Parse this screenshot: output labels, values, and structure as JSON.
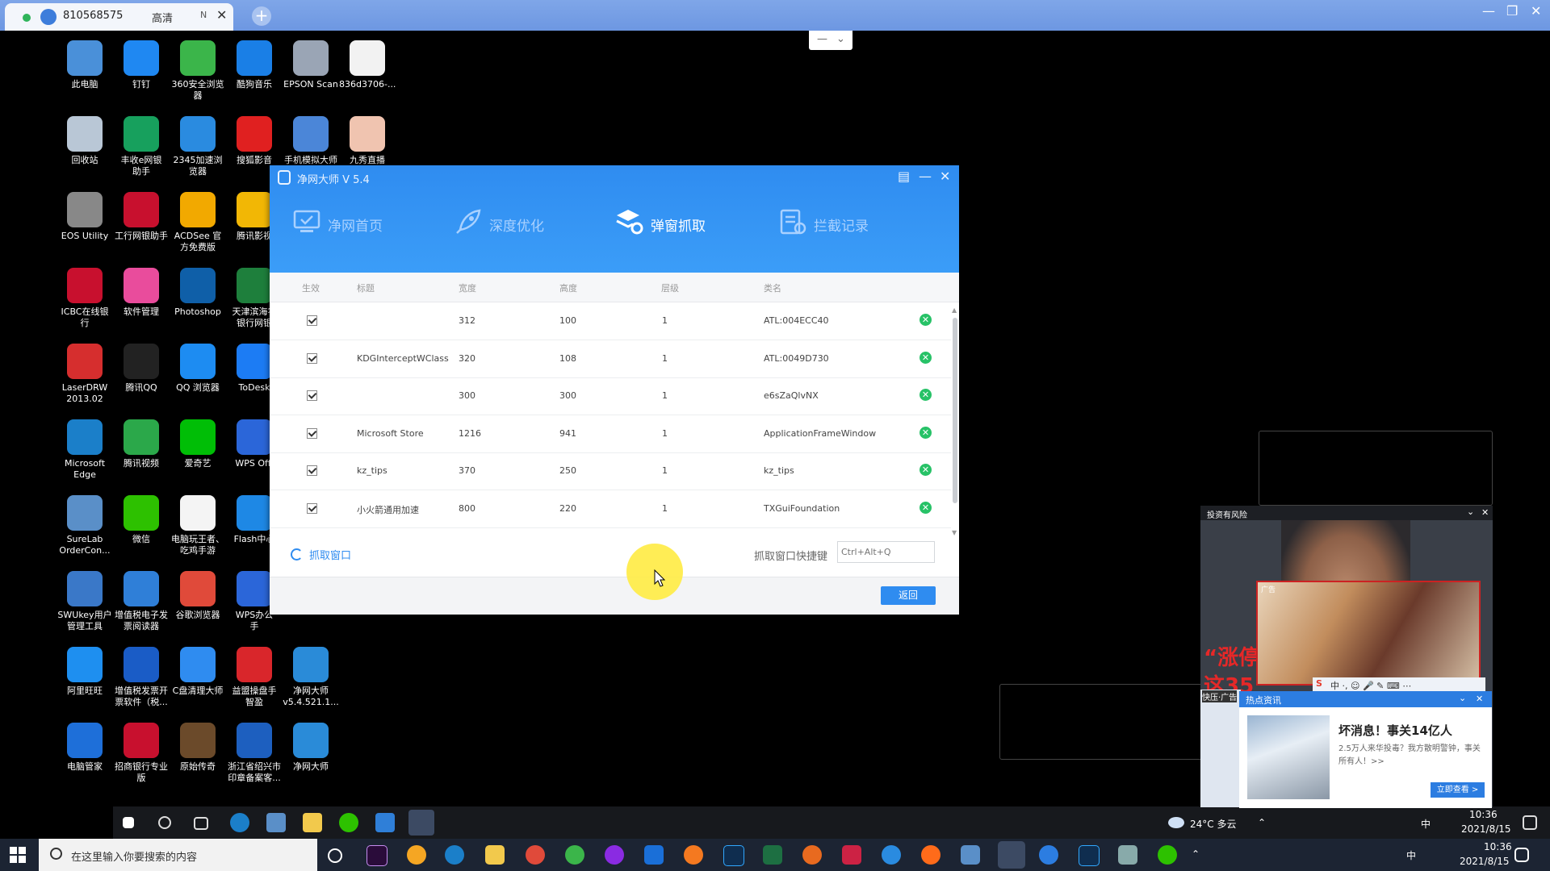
{
  "remote_client": {
    "tab_id": "810568575",
    "quality": "高清",
    "tab_extra": "N",
    "close_glyph": "✕",
    "new_tab_glyph": "+",
    "window_controls": [
      "—",
      "❐",
      "✕"
    ],
    "mini_toolbar": [
      "—",
      "⌄"
    ]
  },
  "desktop_icons": [
    {
      "label": "此电脑",
      "color": "#4a90d9"
    },
    {
      "label": "钉钉",
      "color": "#1f88f2"
    },
    {
      "label": "360安全浏览\n器",
      "color": "#3bb54a"
    },
    {
      "label": "酷狗音乐",
      "color": "#1a7fe6"
    },
    {
      "label": "EPSON Scan",
      "color": "#9aa5b5"
    },
    {
      "label": "836d3706-...",
      "color": "#f2f2f2"
    },
    {
      "label": "回收站",
      "color": "#b9c7d6"
    },
    {
      "label": "丰收e网银\n助手",
      "color": "#17a05d"
    },
    {
      "label": "2345加速浏\n览器",
      "color": "#2a8be0"
    },
    {
      "label": "搜狐影音",
      "color": "#e02020"
    },
    {
      "label": "手机模拟大师",
      "color": "#4b86d8"
    },
    {
      "label": "九秀直播",
      "color": "#f0c4b0"
    },
    {
      "label": "EOS Utility",
      "color": "#888888"
    },
    {
      "label": "工行网银助手",
      "color": "#c8102e"
    },
    {
      "label": "ACDSee 官\n方免费版",
      "color": "#f2a900"
    },
    {
      "label": "腾讯影视",
      "color": "#f2b705"
    },
    {
      "label": "ICBC在线银\n行",
      "color": "#c8102e"
    },
    {
      "label": "软件管理",
      "color": "#e94c9c"
    },
    {
      "label": "Photoshop",
      "color": "#0f5fa8"
    },
    {
      "label": "天津滨海农\n银行网银",
      "color": "#1e7f3c"
    },
    {
      "label": "LaserDRW\n2013.02",
      "color": "#d62e2e"
    },
    {
      "label": "腾讯QQ",
      "color": "#222222"
    },
    {
      "label": "QQ 浏览器",
      "color": "#1d8cf2"
    },
    {
      "label": "ToDesk",
      "color": "#1c7cf4"
    },
    {
      "label": "Microsoft\nEdge",
      "color": "#1b7fc9"
    },
    {
      "label": "腾讯视频",
      "color": "#2ba84a"
    },
    {
      "label": "爱奇艺",
      "color": "#00be06"
    },
    {
      "label": "WPS Offi",
      "color": "#2b66d9"
    },
    {
      "label": "SureLab\nOrderCon...",
      "color": "#5a8fc8"
    },
    {
      "label": "微信",
      "color": "#2dc100"
    },
    {
      "label": "电脑玩王者、\n吃鸡手游",
      "color": "#f4f4f4"
    },
    {
      "label": "Flash中心",
      "color": "#1e88e5"
    },
    {
      "label": "SWUkey用户\n管理工具",
      "color": "#3a78c8"
    },
    {
      "label": "增值税电子发\n票阅读器",
      "color": "#2f7fd8"
    },
    {
      "label": "谷歌浏览器",
      "color": "#e04a3a"
    },
    {
      "label": "WPS办公\n手",
      "color": "#2b66d9"
    },
    {
      "label": "阿里旺旺",
      "color": "#1e8ff0"
    },
    {
      "label": "增值税发票开\n票软件（税...",
      "color": "#1a5cc6"
    },
    {
      "label": "C盘清理大师",
      "color": "#2f8cf0"
    },
    {
      "label": "益盟操盘手\n智盈",
      "color": "#d9262b"
    },
    {
      "label": "净网大师\nv5.4.521.1...",
      "color": "#2a8bd8"
    },
    {
      "label": "电脑管家",
      "color": "#1e6fd9"
    },
    {
      "label": "招商银行专业\n版",
      "color": "#c8102e"
    },
    {
      "label": "原始传奇",
      "color": "#6b4a2a"
    },
    {
      "label": "浙江省绍兴市\n印章备案客...",
      "color": "#1d5fbf"
    },
    {
      "label": "净网大师",
      "color": "#2a8bd8"
    }
  ],
  "app": {
    "title": "净网大师 V 5.4",
    "controls": [
      "▤",
      "—",
      "✕"
    ],
    "tabs": [
      {
        "label": "净网首页",
        "icon": "monitor-check-icon"
      },
      {
        "label": "深度优化",
        "icon": "rocket-icon"
      },
      {
        "label": "弹窗抓取",
        "icon": "grab-popup-icon"
      },
      {
        "label": "拦截记录",
        "icon": "intercept-log-icon"
      }
    ],
    "columns": [
      "生效",
      "标题",
      "宽度",
      "高度",
      "层级",
      "类名"
    ],
    "rows": [
      {
        "title": "",
        "width": "312",
        "height": "100",
        "level": "1",
        "class": "ATL:004ECC40"
      },
      {
        "title": "KDGInterceptWClass",
        "width": "320",
        "height": "108",
        "level": "1",
        "class": "ATL:0049D730"
      },
      {
        "title": "",
        "width": "300",
        "height": "300",
        "level": "1",
        "class": "e6sZaQlvNX"
      },
      {
        "title": "Microsoft Store",
        "width": "1216",
        "height": "941",
        "level": "1",
        "class": "ApplicationFrameWindow"
      },
      {
        "title": "kz_tips",
        "width": "370",
        "height": "250",
        "level": "1",
        "class": "kz_tips"
      },
      {
        "title": "小火箭通用加速",
        "width": "800",
        "height": "220",
        "level": "1",
        "class": "TXGuiFoundation"
      }
    ],
    "grab_label": "抓取窗口",
    "hotkey_label": "抓取窗口快捷键",
    "hotkey_placeholder": "Ctrl+Alt+Q",
    "back_label": "返回",
    "accent": "#2f8cf0",
    "ok_color": "#27c267"
  },
  "popups": {
    "video_title": "投资有风险",
    "video_caption_1": "“涨停",
    "video_caption_2": "这35",
    "ad_label": "广告",
    "ime_text": "中 ·, ☺ 🎤 ✎ ⌨ ⋯",
    "side_ad_label": "快压·广告",
    "news_header": "热点资讯",
    "news_title": "坏消息！事关14亿人",
    "news_body": "2.5万人来华投毒？我方散明警钟，事关所有人！>>",
    "news_button": "立即查看 >",
    "close_glyph": "✕",
    "expand_glyph": "⌄"
  },
  "remote_taskbar": {
    "weather": "24°C 多云",
    "time": "10:36",
    "date": "2021/8/15",
    "ime": "中"
  },
  "local_taskbar": {
    "search_placeholder": "在这里输入你要搜索的内容",
    "time": "10:36",
    "date": "2021/8/15",
    "ime": "中"
  }
}
